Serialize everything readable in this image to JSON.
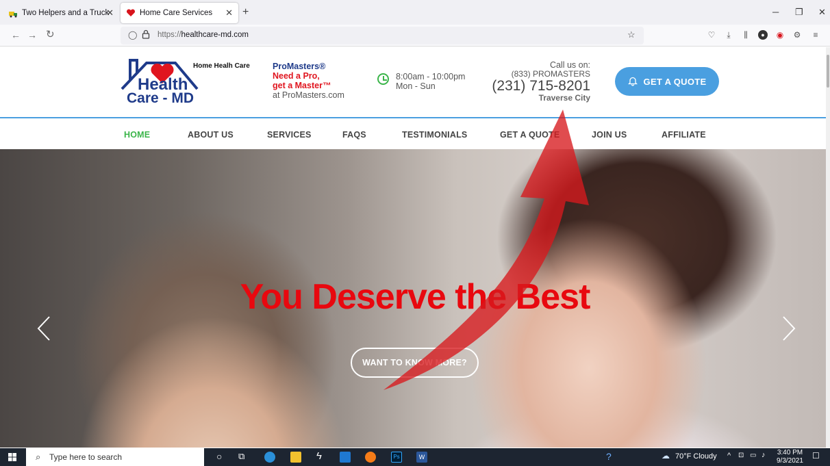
{
  "browser": {
    "tabs": [
      {
        "title": "Two Helpers and a Truck",
        "active": false
      },
      {
        "title": "Home Care Services",
        "active": true
      }
    ],
    "url_protocol": "https://",
    "url_host": "healthcare-md.com"
  },
  "site": {
    "logo_line1": "Health",
    "logo_line2": "Care - MD",
    "logo_tagline": "Home Healh Care",
    "promo": {
      "line1": "ProMasters®",
      "line2": "Need a Pro,",
      "line3": "get a Master™",
      "line4": "at ProMasters.com"
    },
    "hours": {
      "time": "8:00am - 10:00pm",
      "days": "Mon - Sun"
    },
    "call": {
      "label": "Call us on:",
      "vanity": "(833) PROMASTERS",
      "phone": "(231) 715-8201",
      "city": "Traverse City"
    },
    "quote_button": "GET A QUOTE",
    "nav": [
      "HOME",
      "ABOUT US",
      "SERVICES",
      "FAQS",
      "TESTIMONIALS",
      "GET A QUOTE",
      "JOIN US",
      "AFFILIATE"
    ],
    "nav_active": "HOME",
    "hero": {
      "title": "You Deserve the Best",
      "cta": "WANT TO KNOW MORE?"
    },
    "colors": {
      "accent": "#4a9fe0",
      "active_nav": "#3bb54a",
      "hero_title": "#e8080f",
      "brand_navy": "#1f3b8a",
      "brand_red": "#e0151f"
    }
  },
  "taskbar": {
    "search_placeholder": "Type here to search",
    "weather": "70°F  Cloudy",
    "time": "3:40 PM",
    "date": "9/3/2021"
  }
}
